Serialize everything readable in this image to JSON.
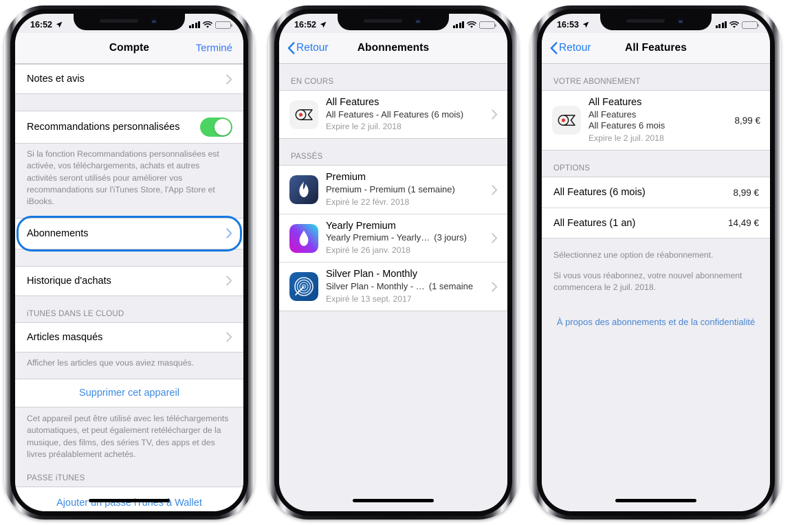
{
  "colors": {
    "accent_blue": "#3478f6",
    "link_blue": "#3d8ae2",
    "highlight_ring": "#1578e0",
    "toggle_green": "#4cd463",
    "screen_bg": "#eeeef3",
    "cell_bg": "#ffffff",
    "header_gray": "#8a8a8f"
  },
  "phones": [
    {
      "id": "phone-account",
      "status": {
        "time": "16:52",
        "location_icon": "location-arrow-icon",
        "signal_icon": "cellular-bars-icon",
        "wifi_icon": "wifi-icon",
        "battery_icon": "battery-icon"
      },
      "nav": {
        "title": "Compte",
        "right_button": "Terminé"
      },
      "sections": [
        {
          "rows": [
            {
              "label": "Notes et avis",
              "chevron": true
            }
          ]
        },
        {
          "rows": [
            {
              "label": "Recommandations personnalisées",
              "toggle": true
            }
          ],
          "footer": "Si la fonction Recommandations personnalisées est activée, vos téléchargements, achats et autres activités seront utilisés pour améliorer vos recommandations sur l'iTunes Store, l'App Store et iBooks."
        },
        {
          "rows": [
            {
              "label": "Abonnements",
              "chevron": true,
              "highlighted": true
            }
          ]
        },
        {
          "rows": [
            {
              "label": "Historique d'achats",
              "chevron": true
            }
          ]
        },
        {
          "header": "iTUNES DANS LE CLOUD",
          "rows": [
            {
              "label": "Articles masqués",
              "chevron": true
            }
          ],
          "footer": "Afficher les articles que vous aviez masqués."
        },
        {
          "link": "Supprimer cet appareil",
          "footer": "Cet appareil peut être utilisé avec les téléchargements automatiques, et peut également retélécharger de la musique, des films, des séries TV, des apps et des livres préalablement achetés."
        },
        {
          "header": "PASSE iTUNES",
          "link_cut": "Ajouter un passe iTunes à Wallet"
        }
      ]
    },
    {
      "id": "phone-subscriptions",
      "status": {
        "time": "16:52"
      },
      "nav": {
        "back_label": "Retour",
        "title": "Abonnements"
      },
      "groups": [
        {
          "header": "EN COURS",
          "items": [
            {
              "icon": "all-features-app-icon",
              "title": "All Features",
              "subtitle": "All Features - All Features (6 mois)",
              "expiry": "Expire le 2 juil. 2018",
              "chevron": true
            }
          ]
        },
        {
          "header": "PASSÉS",
          "items": [
            {
              "icon": "premium-flame-app-icon",
              "title": "Premium",
              "subtitle": "Premium - Premium (1 semaine)",
              "expiry": "Expiré le 22 févr. 2018",
              "chevron": true
            },
            {
              "icon": "yearly-premium-droplet-app-icon",
              "title": "Yearly Premium",
              "subtitle": "Yearly Premium - Yearly…",
              "subtitle_suffix": "(3 jours)",
              "expiry": "Expiré le 26 janv. 2018",
              "chevron": true
            },
            {
              "icon": "silver-plan-radar-app-icon",
              "title": "Silver Plan - Monthly",
              "subtitle": "Silver Plan - Monthly - …",
              "subtitle_suffix": "(1 semaine",
              "expiry": "Expiré le 13 sept. 2017",
              "chevron": true
            }
          ]
        }
      ]
    },
    {
      "id": "phone-all-features",
      "status": {
        "time": "16:53"
      },
      "nav": {
        "back_label": "Retour",
        "title": "All Features"
      },
      "subscription_section": {
        "header": "VOTRE ABONNEMENT",
        "item": {
          "icon": "all-features-app-icon",
          "line1": "All Features",
          "line2": "All Features",
          "line3": "All Features 6 mois",
          "expiry": "Expire le 2 juil. 2018",
          "price": "8,99 €"
        }
      },
      "options_section": {
        "header": "OPTIONS",
        "options": [
          {
            "label": "All Features (6 mois)",
            "price": "8,99 €"
          },
          {
            "label": "All Features (1 an)",
            "price": "14,49 €"
          }
        ],
        "footer_line1": "Sélectionnez une option de réabonnement.",
        "footer_line2": "Si vous vous réabonnez, votre nouvel abonnement commencera le 2 juil. 2018.",
        "link": "À propos des abonnements et de la confidentialité"
      }
    }
  ]
}
